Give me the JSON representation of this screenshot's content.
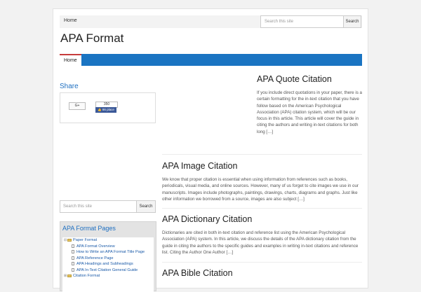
{
  "topbar": {
    "home": "Home",
    "search_placeholder": "Search this site",
    "search_button": "Search"
  },
  "site": {
    "title": "APA Format"
  },
  "nav": {
    "home": "Home"
  },
  "share": {
    "title": "Share",
    "gplus": "G+",
    "fb_count": "350",
    "fb_like": "👍 86 place"
  },
  "sidebar_search": {
    "placeholder": "Search this site",
    "button": "Search"
  },
  "pages_widget": {
    "title": "APA Format Pages",
    "items": [
      {
        "label": "Paper Format",
        "type": "folder"
      },
      {
        "label": "APA Format Overview",
        "type": "doc"
      },
      {
        "label": "How to Write an APA Format Title Page",
        "type": "doc"
      },
      {
        "label": "APA Reference Page",
        "type": "doc"
      },
      {
        "label": "APA Headings and Subheadings",
        "type": "doc"
      },
      {
        "label": "APA In-Text Citation General Guide",
        "type": "doc"
      },
      {
        "label": "Citation Format",
        "type": "folder"
      }
    ]
  },
  "articles": [
    {
      "title": "APA Quote Citation",
      "excerpt": "If you include direct quotations in your paper, there is a certain formatting for the in-text citation that you have follow based on the American Psychological Association (APA) citation system, which will be our focus in this article. This article will cover the guide in citing the authors and writing in-text citations for both long […]"
    },
    {
      "title": "APA Image Citation",
      "excerpt": "We know that proper citation is essential when using information from references such as books, periodicals, visual media, and online sources. However, many of us forget to cite images we use in our manuscripts. Images include photographs, paintings, drawings, charts, diagrams and graphs. Just like other information we borrowed from a source, images are also subject […]"
    },
    {
      "title": "APA Dictionary Citation",
      "excerpt": "Dictionaries are cited in both in-text citation and reference list using the American Psychological Association (APA) system. In this article, we discuss the details of the APA dictionary citation from the guide in citing the authors to the specific guides and examples in writing in-text citations and reference list.    Citing the Author One Author […]"
    },
    {
      "title": "APA Bible Citation",
      "excerpt": ""
    }
  ]
}
